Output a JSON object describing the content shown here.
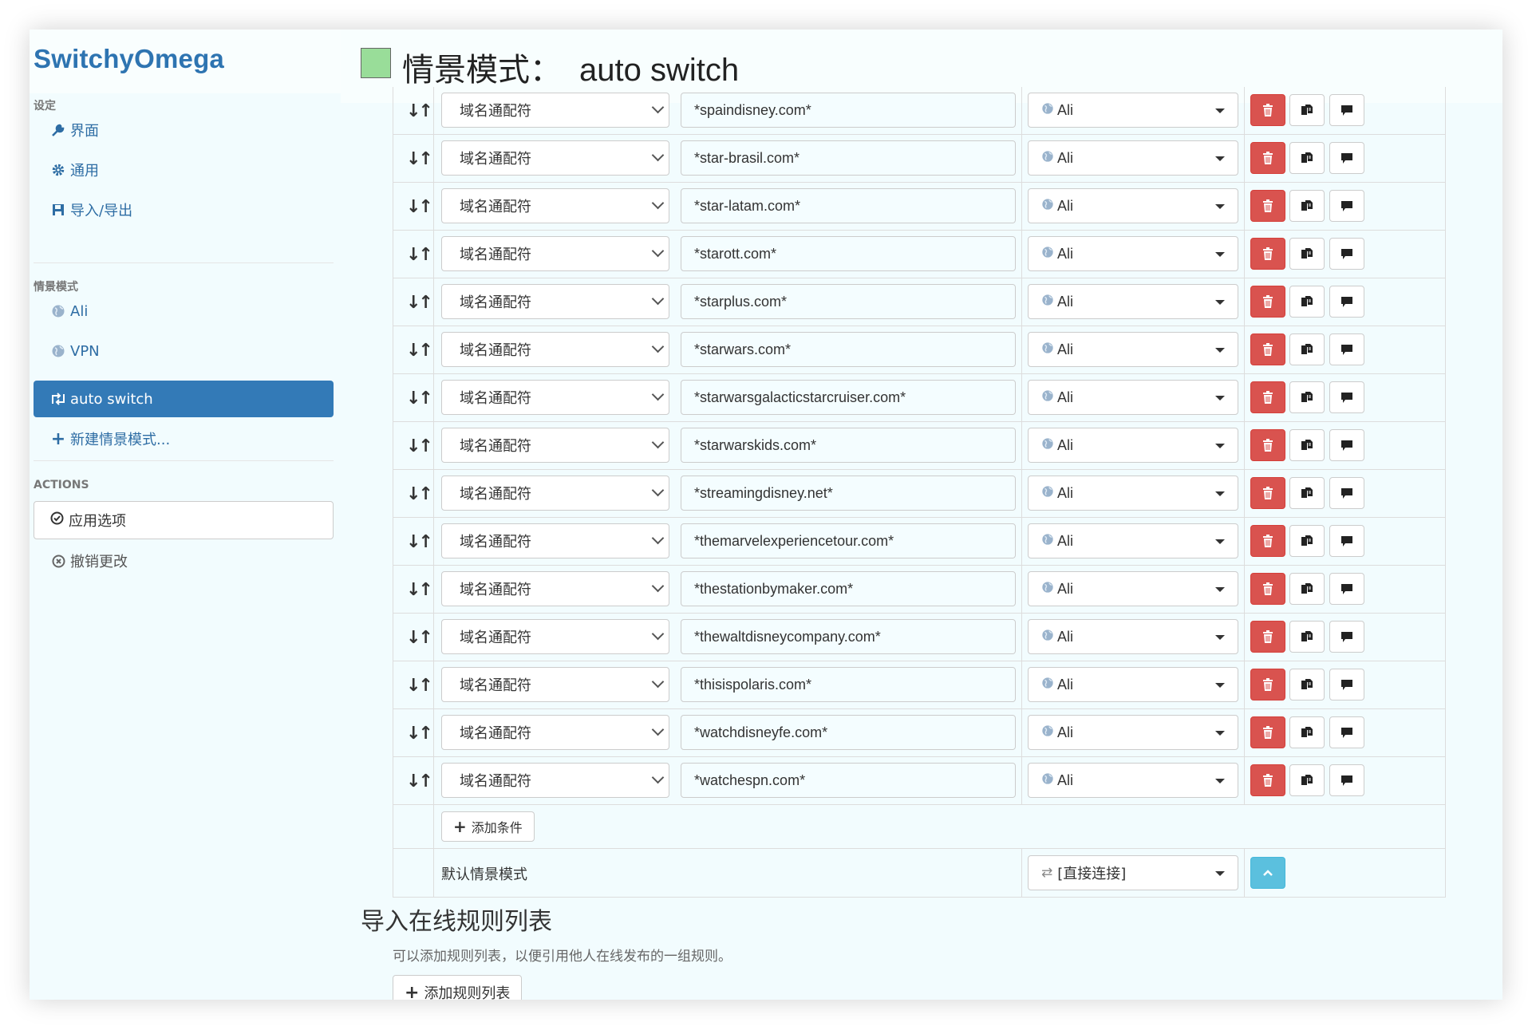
{
  "app": {
    "brand": "SwitchyOmega"
  },
  "sidebar": {
    "settings_header": "设定",
    "settings_items": [
      {
        "label": "界面",
        "icon": "wrench-icon"
      },
      {
        "label": "通用",
        "icon": "gear-icon"
      },
      {
        "label": "导入/导出",
        "icon": "floppy-icon"
      }
    ],
    "profiles_header": "情景模式",
    "profile_items": [
      {
        "label": "Ali",
        "icon": "globe-icon"
      },
      {
        "label": "VPN",
        "icon": "globe-icon"
      },
      {
        "label": "auto switch",
        "icon": "switch-icon",
        "active": true
      }
    ],
    "new_profile": "新建情景模式...",
    "actions_header": "ACTIONS",
    "apply": "应用选项",
    "revert": "撤销更改"
  },
  "header": {
    "prefix": "情景模式：",
    "name": "auto switch",
    "swatch_color": "#99dd99"
  },
  "rules": {
    "condition_type": "域名通配符",
    "rows": [
      {
        "pattern": "*spaindisney.com*",
        "profile": "Ali"
      },
      {
        "pattern": "*star-brasil.com*",
        "profile": "Ali"
      },
      {
        "pattern": "*star-latam.com*",
        "profile": "Ali"
      },
      {
        "pattern": "*starott.com*",
        "profile": "Ali"
      },
      {
        "pattern": "*starplus.com*",
        "profile": "Ali"
      },
      {
        "pattern": "*starwars.com*",
        "profile": "Ali"
      },
      {
        "pattern": "*starwarsgalacticstarcruiser.com*",
        "profile": "Ali"
      },
      {
        "pattern": "*starwarskids.com*",
        "profile": "Ali"
      },
      {
        "pattern": "*streamingdisney.net*",
        "profile": "Ali"
      },
      {
        "pattern": "*themarvelexperiencetour.com*",
        "profile": "Ali"
      },
      {
        "pattern": "*thestationbymaker.com*",
        "profile": "Ali"
      },
      {
        "pattern": "*thewaltdisneycompany.com*",
        "profile": "Ali"
      },
      {
        "pattern": "*thisispolaris.com*",
        "profile": "Ali"
      },
      {
        "pattern": "*watchdisneyfe.com*",
        "profile": "Ali"
      },
      {
        "pattern": "*watchespn.com*",
        "profile": "Ali"
      }
    ],
    "add_condition": "添加条件",
    "default_label": "默认情景模式",
    "default_profile": "[直接连接]"
  },
  "import": {
    "title": "导入在线规则列表",
    "description": "可以添加规则列表，以便引用他人在线发布的一组规则。",
    "button": "添加规则列表"
  },
  "colors": {
    "accent": "#337ab7",
    "danger": "#d9534f",
    "info": "#5bc0de",
    "page_bg": "#f2fcfe"
  }
}
